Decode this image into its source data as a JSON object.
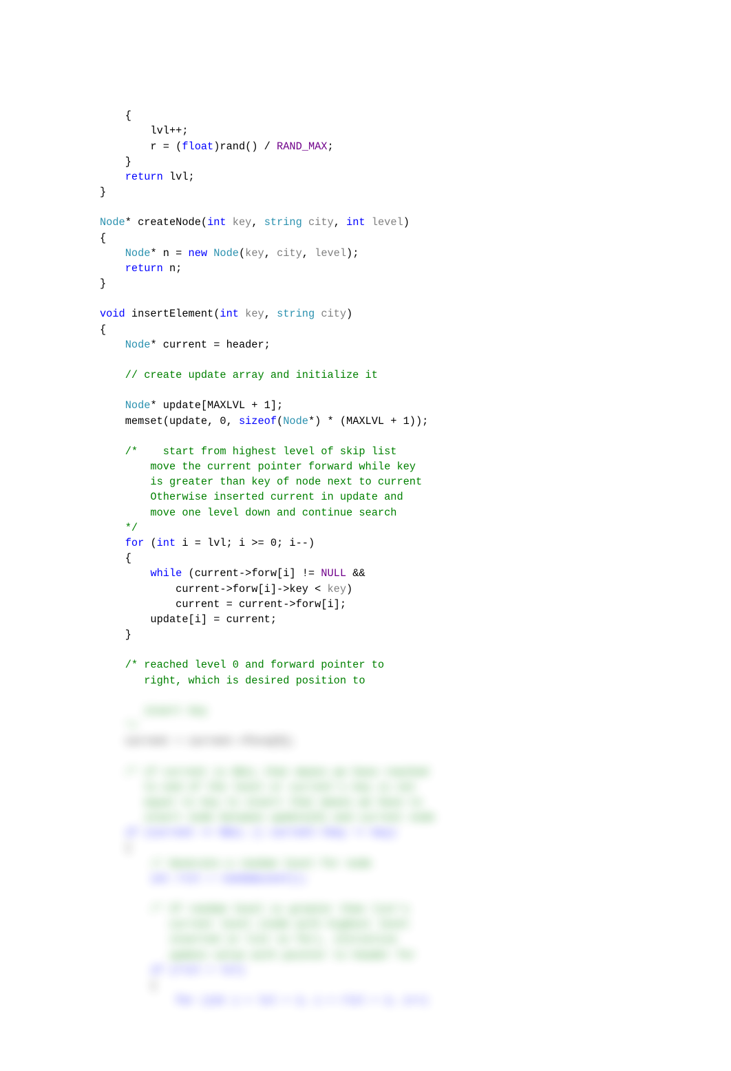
{
  "code": {
    "l01": "    {",
    "l02": "        lvl++;",
    "l03a": "        r = (",
    "l03b": "float",
    "l03c": ")rand() / ",
    "l03d": "RAND_MAX",
    "l03e": ";",
    "l04": "    }",
    "l05a": "    ",
    "l05b": "return",
    "l05c": " lvl;",
    "l06": "}",
    "l07": "",
    "l08a": "Node",
    "l08b": "* createNode(",
    "l08c": "int",
    "l08d": " ",
    "l08e": "key",
    "l08f": ", ",
    "l08g": "string",
    "l08h": " ",
    "l08i": "city",
    "l08j": ", ",
    "l08k": "int",
    "l08l": " ",
    "l08m": "level",
    "l08n": ")",
    "l09": "{",
    "l10a": "    ",
    "l10b": "Node",
    "l10c": "* n = ",
    "l10d": "new",
    "l10e": " ",
    "l10f": "Node",
    "l10g": "(",
    "l10h": "key",
    "l10i": ", ",
    "l10j": "city",
    "l10k": ", ",
    "l10l": "level",
    "l10m": ");",
    "l11a": "    ",
    "l11b": "return",
    "l11c": " n;",
    "l12": "}",
    "l13": "",
    "l14a": "void",
    "l14b": " insertElement(",
    "l14c": "int",
    "l14d": " ",
    "l14e": "key",
    "l14f": ", ",
    "l14g": "string",
    "l14h": " ",
    "l14i": "city",
    "l14j": ")",
    "l15": "{",
    "l16a": "    ",
    "l16b": "Node",
    "l16c": "* current = header;",
    "l17": "",
    "l18a": "    ",
    "l18b": "// create update array and initialize it",
    "l19": "",
    "l20a": "    ",
    "l20b": "Node",
    "l20c": "* update[MAXLVL + 1];",
    "l21a": "    memset(update, 0, ",
    "l21b": "sizeof",
    "l21c": "(",
    "l21d": "Node",
    "l21e": "*) * (MAXLVL + 1));",
    "l22": "",
    "l23a": "    ",
    "l23b": "/*    start from highest level of skip list",
    "l24": "        move the current pointer forward while key",
    "l25": "        is greater than key of node next to current",
    "l26": "        Otherwise inserted current in update and",
    "l27": "        move one level down and continue search",
    "l28": "    */",
    "l29a": "    ",
    "l29b": "for",
    "l29c": " (",
    "l29d": "int",
    "l29e": " i = lvl; i >= 0; i--)",
    "l30": "    {",
    "l31a": "        ",
    "l31b": "while",
    "l31c": " (current->forw[i] != ",
    "l31d": "NULL",
    "l31e": " &&",
    "l32a": "            current->forw[i]->key < ",
    "l32b": "key",
    "l32c": ")",
    "l33": "            current = current->forw[i];",
    "l34": "        update[i] = current;",
    "l35": "    }",
    "l36": "",
    "l37a": "    ",
    "l37b": "/* reached level 0 and forward pointer to",
    "l38": "       right, which is desired position to",
    "b01": "       insert key",
    "b02": "    */",
    "b03": "    current = current->forw[0];",
    "b04": "",
    "b05": "    /* if current is NULL that means we have reached",
    "b06": "       to end of the level or current's key is not",
    "b07": "       equal to key to insert that means we have to",
    "b08": "       insert node between update[0] and current node",
    "b09": "    if (current == NULL || current->key != key)",
    "b10": "    {",
    "b11": "        // Generate a random level for node",
    "b12": "        int rlvl = randomLevel();",
    "b13": "",
    "b14": "        /* If random level is greater than list's",
    "b15": "           current level (node with highest level",
    "b16": "           inserted in list so far), initialize",
    "b17": "           update value with pointer to header for",
    "b18": "        if (rlvl > lvl)",
    "b19": "        {",
    "b20": "            for (int i = lvl + 1; i < rlvl + 1; i++)"
  }
}
